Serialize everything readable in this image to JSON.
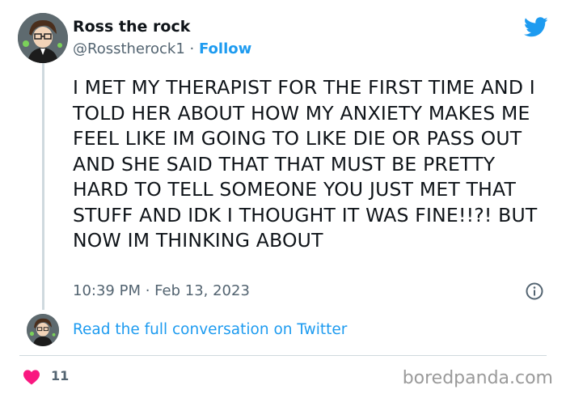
{
  "header": {
    "user_name": "Ross the rock",
    "handle": "@Rosstherock1",
    "separator": " · ",
    "follow_label": "Follow",
    "logo_icon": "twitter-bird-icon"
  },
  "tweet": {
    "text": "I MET MY THERAPIST FOR THE FIRST TIME AND I TOLD HER ABOUT HOW MY ANXIETY MAKES ME FEEL LIKE IM GOING TO LIKE DIE OR PASS OUT AND SHE SAID THAT THAT MUST BE PRETTY HARD TO TELL SOMEONE YOU JUST MET THAT STUFF AND IDK I THOUGHT IT WAS FINE!!?! BUT NOW IM THINKING ABOUT",
    "timestamp": "10:39 PM · Feb 13, 2023"
  },
  "conversation": {
    "link_label": "Read the full conversation on Twitter"
  },
  "footer": {
    "like_count": "11",
    "watermark": "boredpanda.com"
  },
  "colors": {
    "accent": "#1d9bf0",
    "heart": "#f91880",
    "muted": "#536471",
    "text": "#0f1419"
  }
}
